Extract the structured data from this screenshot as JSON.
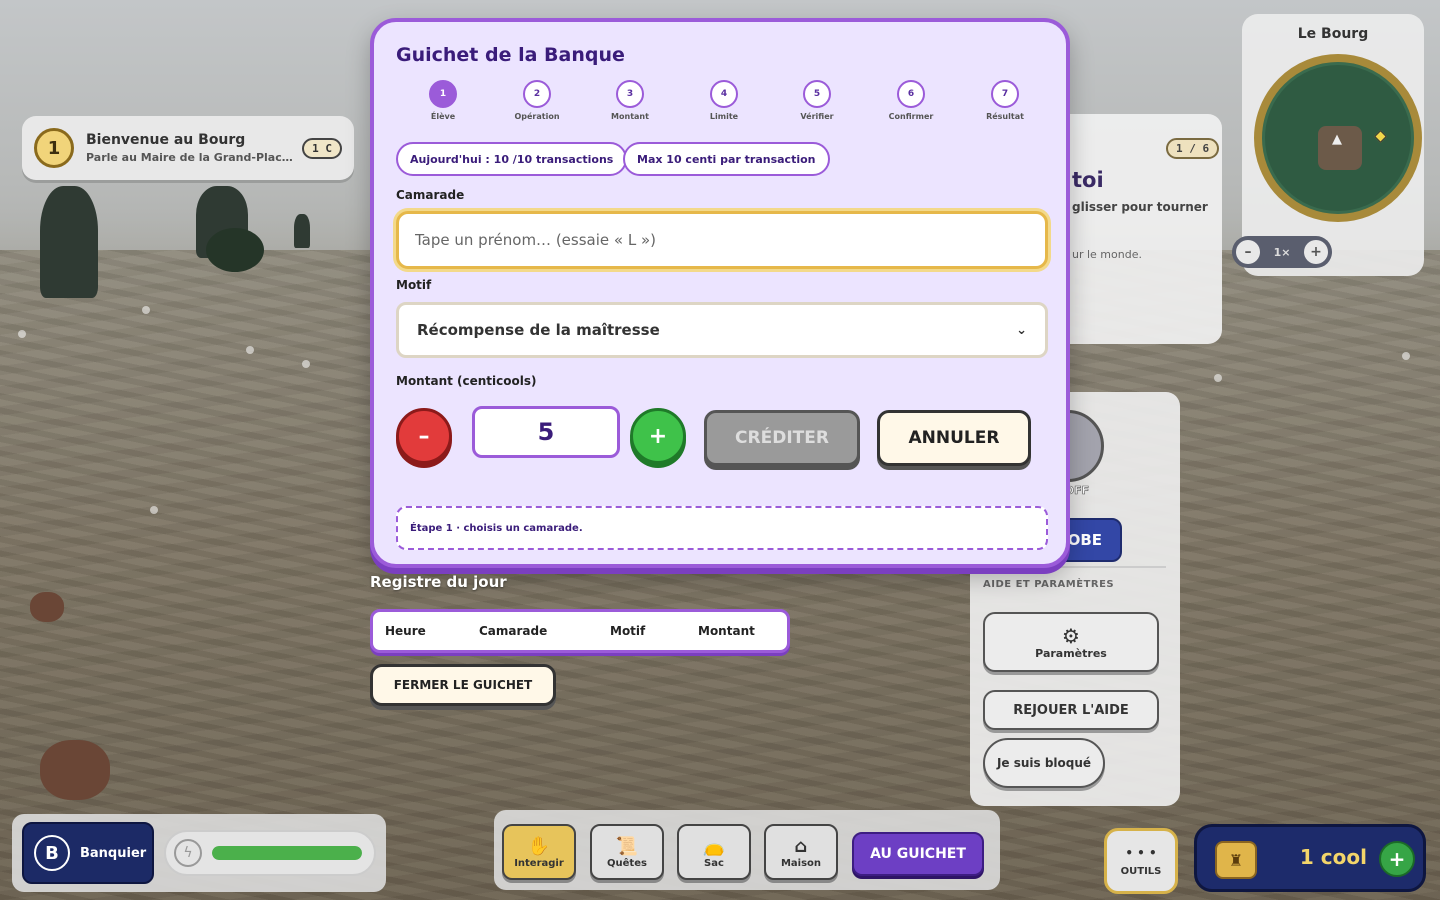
{
  "quest": {
    "number": "1",
    "title": "Bienvenue au Bourg",
    "subtitle": "Parle au Maire de la Grand-Place p...",
    "badge": "1 C"
  },
  "tutorial": {
    "counter": "1 / 6",
    "title_fragment": "toi",
    "line_fragment": "glisser pour tourner",
    "small_fragment": "ur le monde."
  },
  "minimap": {
    "title": "Le Bourg",
    "zoom_level": "1×",
    "zoom_out": "–",
    "zoom_in": "+"
  },
  "side_panel": {
    "run_label": "pide OFF",
    "wardrobe_label": "OBE",
    "section_title": "AIDE ET PARAMÈTRES",
    "settings_label": "Paramètres",
    "replay_help_label": "REJOUER L'AIDE",
    "stuck_label": "Je suis bloqué"
  },
  "bank": {
    "title": "Guichet de la Banque",
    "steps": [
      {
        "num": "1",
        "label": "Élève"
      },
      {
        "num": "2",
        "label": "Opération"
      },
      {
        "num": "3",
        "label": "Montant"
      },
      {
        "num": "4",
        "label": "Limite"
      },
      {
        "num": "5",
        "label": "Vérifier"
      },
      {
        "num": "6",
        "label": "Confirmer"
      },
      {
        "num": "7",
        "label": "Résultat"
      }
    ],
    "active_step": 1,
    "daily_limit": "Aujourd'hui :  10  /10 transactions",
    "max_limit": "Max  10 centi  par transaction",
    "comrade_label": "Camarade",
    "comrade_placeholder": "Tape un prénom… (essaie « L »)",
    "comrade_value": "",
    "motif_label": "Motif",
    "motif_value": "Récompense de la maîtresse",
    "amount_label": "Montant (centicools)",
    "amount_value": "5",
    "minus_label": "–",
    "plus_label": "+",
    "credit_label": "CRÉDITER",
    "cancel_label": "ANNULER",
    "hint": "Étape 1 · choisis un camarade."
  },
  "register": {
    "title": "Registre du jour",
    "columns": [
      "Heure",
      "Camarade",
      "Motif",
      "Montant"
    ],
    "close_label": "FERMER LE GUICHET"
  },
  "hud": {
    "role_initial": "B",
    "role_name": "Banquier",
    "energy_level": 1.0,
    "actions": [
      {
        "label": "Interagir",
        "icon": "hand-icon"
      },
      {
        "label": "Quêtes",
        "icon": "scroll-icon"
      },
      {
        "label": "Sac",
        "icon": "bag-icon"
      },
      {
        "label": "Maison",
        "icon": "house-icon"
      }
    ],
    "guichet_label": "AU GUICHET",
    "tools_label": "OUTILS",
    "tools_icon": "• • •",
    "wallet_amount": "1 cool",
    "wallet_plus": "+"
  },
  "colors": {
    "accent": "#9b5bd9",
    "title": "#3a1c7a",
    "positive": "#3fc24a",
    "negative": "#e23b3b",
    "gold": "#e6b84a"
  }
}
